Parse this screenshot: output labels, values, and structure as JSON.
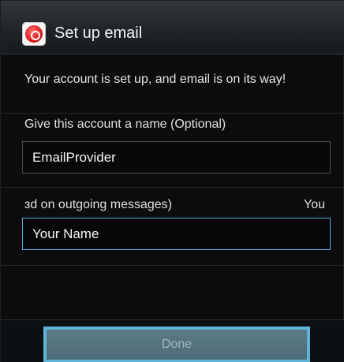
{
  "titlebar": {
    "app_icon": "email-app-icon",
    "title": "Set up email"
  },
  "status_message": "Your account is set up, and email is on its way!",
  "account_name": {
    "label": "Give this account a name (Optional)",
    "value": "EmailProvider"
  },
  "your_name": {
    "label_left": "ɜd on outgoing messages)",
    "label_right": "You",
    "value": "Your Name"
  },
  "done_button": {
    "label": "Done"
  },
  "colors": {
    "focus_border": "#55aee0",
    "button_border": "#5fb3d8",
    "button_fill": "#557580"
  }
}
